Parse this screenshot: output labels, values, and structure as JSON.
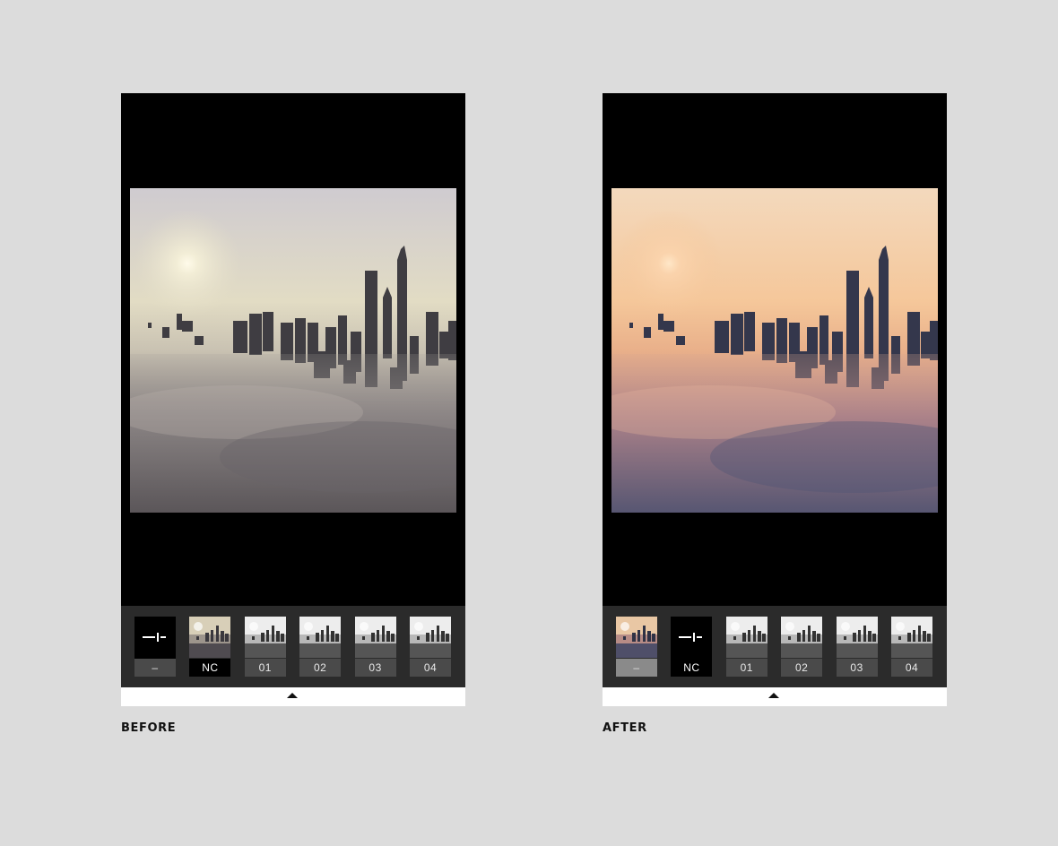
{
  "before": {
    "caption": "BEFORE",
    "filters": [
      {
        "label": "–",
        "kind": "adjust"
      },
      {
        "label": "NC",
        "kind": "photo"
      },
      {
        "label": "01",
        "kind": "photo"
      },
      {
        "label": "02",
        "kind": "photo"
      },
      {
        "label": "03",
        "kind": "photo"
      },
      {
        "label": "04",
        "kind": "photo"
      }
    ],
    "selected": "NC"
  },
  "after": {
    "caption": "AFTER",
    "filters": [
      {
        "label": "–",
        "kind": "photo"
      },
      {
        "label": "NC",
        "kind": "adjust"
      },
      {
        "label": "01",
        "kind": "photo"
      },
      {
        "label": "02",
        "kind": "photo"
      },
      {
        "label": "03",
        "kind": "photo"
      },
      {
        "label": "04",
        "kind": "photo"
      }
    ],
    "selected": "NC"
  },
  "icons": {
    "adjust": "adjust-slider-icon",
    "panel_toggle": "triangle-up-icon"
  },
  "colors": {
    "background": "#dcdcdc",
    "phone": "#000000",
    "strip": "#2b2b2b",
    "label": "#4a4a4a"
  }
}
